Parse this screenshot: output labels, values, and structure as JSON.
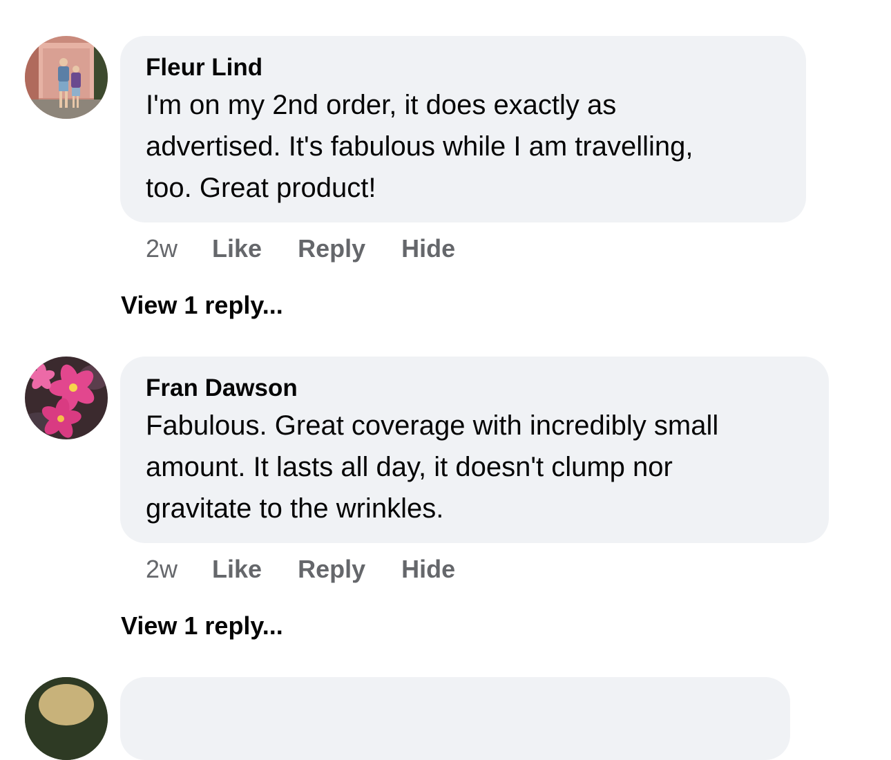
{
  "comments": [
    {
      "author": "Fleur Lind",
      "avatar_icon": "couple-photo-avatar",
      "lines": [
        "I'm on my 2nd order, it does exactly as",
        "advertised. It's fabulous while I am travelling,",
        "too. Great product!"
      ],
      "time": "2w",
      "like_label": "Like",
      "reply_label": "Reply",
      "hide_label": "Hide",
      "view_replies_label": "View 1 reply..."
    },
    {
      "author": "Fran Dawson",
      "avatar_icon": "pink-flower-avatar",
      "lines": [
        "Fabulous. Great coverage with incredibly small",
        "amount. It lasts all day, it doesn't clump nor",
        "gravitate to the wrinkles."
      ],
      "time": "2w",
      "like_label": "Like",
      "reply_label": "Reply",
      "hide_label": "Hide",
      "view_replies_label": "View 1 reply..."
    }
  ],
  "colors": {
    "bubble_bg": "#f0f2f5",
    "primary_text": "#050505",
    "secondary_text": "#65676b"
  }
}
